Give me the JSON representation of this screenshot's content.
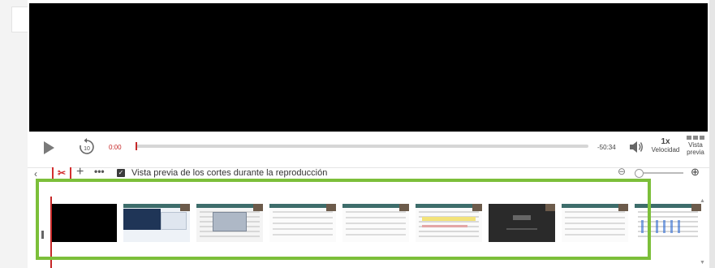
{
  "player": {
    "current_time": "0:00",
    "remaining_time": "-50:34",
    "progress_fraction": 0.0,
    "speed_value": "1x",
    "speed_label": "Velocidad",
    "preview_label": "Vista previa"
  },
  "editor": {
    "preview_cuts_checked": true,
    "preview_cuts_label": "Vista previa de los cortes durante la reproducción",
    "zoom_fraction": 0.0
  },
  "timeline": {
    "thumbnails": [
      "black",
      "webpage",
      "dialog",
      "document",
      "document",
      "document-highlight",
      "document",
      "dark-screen",
      "spreadsheet"
    ]
  },
  "colors": {
    "accent_red": "#c62828",
    "highlight_green": "#7cbf3a"
  }
}
